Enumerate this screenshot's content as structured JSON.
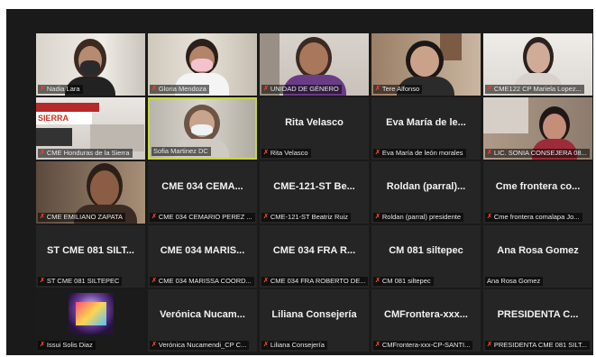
{
  "participants": [
    {
      "label": "Nadia Lara",
      "muted": true,
      "video": true
    },
    {
      "label": "Gloria Mendoza",
      "muted": true,
      "video": true
    },
    {
      "label": "UNIDAD DE GÉNERO",
      "muted": true,
      "video": true
    },
    {
      "label": "Tere Alfonso",
      "muted": true,
      "video": true
    },
    {
      "label": "CME122 CP Mariela Lopez...",
      "muted": true,
      "video": true
    },
    {
      "label": "CME Honduras de la Sierra",
      "muted": true,
      "video": true
    },
    {
      "label": "Sofia Martinez DC",
      "muted": false,
      "video": true,
      "active": true
    },
    {
      "display": "Rita Velasco",
      "label": "Rita Velasco",
      "muted": true,
      "video": false
    },
    {
      "display": "Eva María de le...",
      "label": "Eva María de león morales",
      "muted": true,
      "video": false
    },
    {
      "label": "LIC. SONIA CONSEJERA 08...",
      "muted": true,
      "video": true
    },
    {
      "label": "CME EMILIANO ZAPATA",
      "muted": true,
      "video": true
    },
    {
      "display": "CME 034 CEMA...",
      "label": "CME 034 CEMARIO PEREZ ...",
      "muted": true,
      "video": false
    },
    {
      "display": "CME-121-ST Be...",
      "label": "CME-121-ST Beatriz Ruiz",
      "muted": true,
      "video": false
    },
    {
      "display": "Roldan (parral)...",
      "label": "Roldan (parral) presidente",
      "muted": true,
      "video": false
    },
    {
      "display": "Cme frontera co...",
      "label": "Cme frontera comalapa Jo...",
      "muted": true,
      "video": false
    },
    {
      "display": "ST CME 081 SILT...",
      "label": "ST CME 081 SILTEPEC",
      "muted": true,
      "video": false
    },
    {
      "display": "CME 034 MARIS...",
      "label": "CME 034 MARISSA COORD...",
      "muted": true,
      "video": false
    },
    {
      "display": "CME 034 FRA R...",
      "label": "CME 034 FRA ROBERTO DE...",
      "muted": true,
      "video": false
    },
    {
      "display": "CM  081 siltepec",
      "label": "CM  081 siltepec",
      "muted": true,
      "video": false
    },
    {
      "display": "Ana Rosa Gomez",
      "label": "Ana Rosa Gomez",
      "muted": false,
      "video": false
    },
    {
      "label": "Issui Solis Diaz",
      "muted": true,
      "video": true
    },
    {
      "display": "Verónica  Nucam...",
      "label": "Verónica Nucamendi_CP C...",
      "muted": true,
      "video": false
    },
    {
      "display": "Liliana Consejería",
      "label": "Liliana Consejería",
      "muted": true,
      "video": false
    },
    {
      "display": "CMFrontera-xxx...",
      "label": "CMFrontera-xxx-CP-SANTI...",
      "muted": true,
      "video": false
    },
    {
      "display": "PRESIDENTA  C...",
      "label": "PRESIDENTA CME 081 SILT...",
      "muted": true,
      "video": false
    }
  ],
  "colors": {
    "background": "#1a1a1a",
    "tile": "#252525",
    "active_border": "#c7d63e",
    "muted_icon": "#e8402f"
  }
}
